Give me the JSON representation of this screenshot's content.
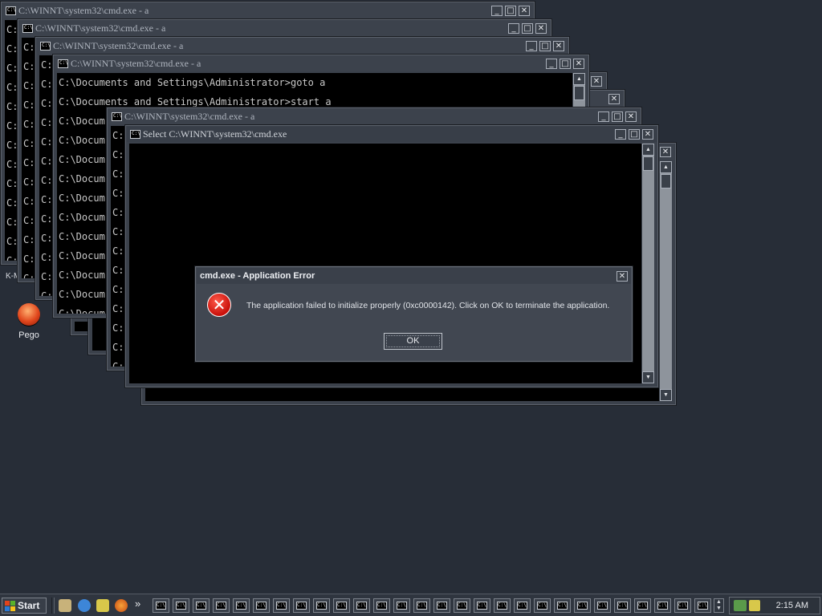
{
  "windows": [
    {
      "title": "C:\\WINNT\\system32\\cmd.exe - a",
      "lines": [
        "C:",
        "C:",
        "C:",
        "C:",
        "C:",
        "C:",
        "C:",
        "C:",
        "C:",
        "C:",
        "C:",
        "C:",
        "C:"
      ]
    },
    {
      "title": "C:\\WINNT\\system32\\cmd.exe - a",
      "lines": [
        "C:",
        "C:",
        "C:",
        "C:",
        "C:",
        "C:",
        "C:",
        "C:",
        "C:",
        "C:",
        "C:",
        "C:",
        "C:"
      ]
    },
    {
      "title": "C:\\WINNT\\system32\\cmd.exe - a",
      "lines": [
        "C:",
        "C:",
        "C:",
        "C:",
        "C:",
        "C:",
        "C:",
        "C:",
        "C:",
        "C:",
        "C:",
        "C:",
        "C:"
      ]
    },
    {
      "title": "C:\\WINNT\\system32\\cmd.exe - a",
      "lines": [
        "C:\\Documents and Settings\\Administrator>goto a",
        "C:\\Documents and Settings\\Administrator>start a",
        "C:\\Docum",
        "C:\\Docum",
        "C:\\Docum",
        "C:\\Docum",
        "C:\\Docum",
        "C:\\Docum",
        "C:\\Docum",
        "C:\\Docum",
        "C:\\Docum",
        "C:\\Docum",
        "C:\\Docum"
      ]
    },
    {
      "title": "C:\\WINNT\\system32\\cmd.exe - a",
      "lines": [
        "C:",
        "C:",
        "C:",
        "C:",
        "C:",
        "C:",
        "C:",
        "C:",
        "C:",
        "C:",
        "C:",
        "C:",
        "C:"
      ]
    },
    {
      "title": "Select C:\\WINNT\\system32\\cmd.exe",
      "lines": []
    }
  ],
  "behind_lines": [
    "C:",
    "C:"
  ],
  "dialog": {
    "title": "cmd.exe - Application Error",
    "message": "The application failed to initialize properly (0xc0000142). Click on OK to terminate the application.",
    "ok_label": "OK",
    "icon": "error-icon"
  },
  "desktop": {
    "icon_label": "Pego",
    "km_label": "K-M"
  },
  "taskbar": {
    "start_label": "Start",
    "chevron": "»",
    "task_icon_glyph": "C:\\",
    "task_count": 28,
    "clock": "2:15 AM"
  },
  "colors": {
    "desktop": "#272d37",
    "error_red": "#d0140c"
  }
}
